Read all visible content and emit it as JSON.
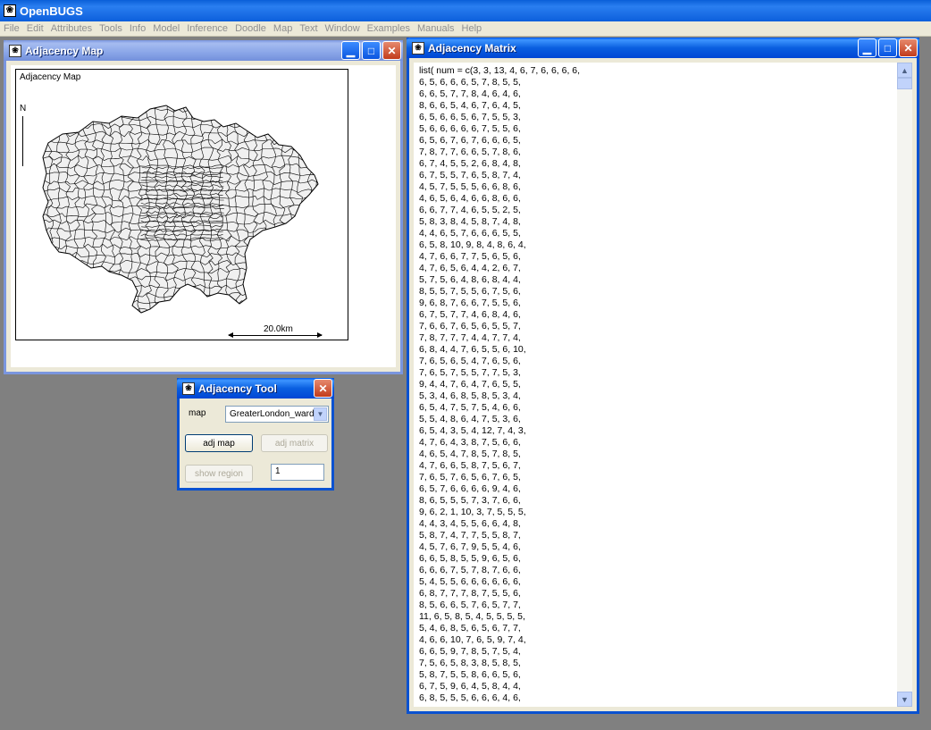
{
  "app": {
    "title": "OpenBUGS",
    "icon": "bugs-icon"
  },
  "menu": [
    "File",
    "Edit",
    "Attributes",
    "Tools",
    "Info",
    "Model",
    "Inference",
    "Doodle",
    "Map",
    "Text",
    "Window",
    "Examples",
    "Manuals",
    "Help"
  ],
  "map_window": {
    "title": "Adjacency Map",
    "map_label": "Adjacency Map",
    "north_label": "N",
    "scale_label": "20.0km"
  },
  "matrix_window": {
    "title": "Adjacency Matrix",
    "lines": [
      "list( num = c(3, 3, 13, 4, 6, 7, 6, 6, 6, 6,",
      "6, 5, 6, 6, 6, 5, 7, 8, 5, 5,",
      "6, 6, 5, 7, 7, 8, 4, 6, 4, 6,",
      "8, 6, 6, 5, 4, 6, 7, 6, 4, 5,",
      "6, 5, 6, 6, 5, 6, 7, 5, 5, 3,",
      "5, 6, 6, 6, 6, 6, 7, 5, 5, 6,",
      "6, 5, 6, 7, 6, 7, 6, 6, 6, 5,",
      "7, 8, 7, 7, 6, 6, 5, 7, 8, 6,",
      "6, 7, 4, 5, 5, 2, 6, 8, 4, 8,",
      "6, 7, 5, 5, 7, 6, 5, 8, 7, 4,",
      "4, 5, 7, 5, 5, 5, 6, 6, 8, 6,",
      "4, 6, 5, 6, 4, 6, 6, 8, 6, 6,",
      "6, 6, 7, 7, 4, 6, 5, 5, 2, 5,",
      "5, 8, 3, 8, 4, 5, 8, 7, 4, 8,",
      "4, 4, 6, 5, 7, 6, 6, 6, 5, 5,",
      "6, 5, 8, 10, 9, 8, 4, 8, 6, 4,",
      "4, 7, 6, 6, 7, 7, 5, 6, 5, 6,",
      "4, 7, 6, 5, 6, 4, 4, 2, 6, 7,",
      "5, 7, 5, 6, 4, 8, 6, 8, 4, 4,",
      "8, 5, 5, 7, 5, 5, 6, 7, 5, 6,",
      "9, 6, 8, 7, 6, 6, 7, 5, 5, 6,",
      "6, 7, 5, 7, 7, 4, 6, 8, 4, 6,",
      "7, 6, 6, 7, 6, 5, 6, 5, 5, 7,",
      "7, 8, 7, 7, 7, 4, 4, 7, 7, 4,",
      "6, 8, 4, 4, 7, 6, 5, 5, 6, 10,",
      "7, 6, 5, 6, 5, 4, 7, 6, 5, 6,",
      "7, 6, 5, 7, 5, 5, 7, 7, 5, 3,",
      "9, 4, 4, 7, 6, 4, 7, 6, 5, 5,",
      "5, 3, 4, 6, 8, 5, 8, 5, 3, 4,",
      "6, 5, 4, 7, 5, 7, 5, 4, 6, 6,",
      "5, 5, 4, 8, 6, 4, 7, 5, 3, 6,",
      "6, 5, 4, 3, 5, 4, 12, 7, 4, 3,",
      "4, 7, 6, 4, 3, 8, 7, 5, 6, 6,",
      "4, 6, 5, 4, 7, 8, 5, 7, 8, 5,",
      "4, 7, 6, 6, 5, 8, 7, 5, 6, 7,",
      "7, 6, 5, 7, 6, 5, 6, 7, 6, 5,",
      "6, 5, 7, 6, 6, 6, 6, 9, 4, 6,",
      "8, 6, 5, 5, 5, 7, 3, 7, 6, 6,",
      "9, 6, 2, 1, 10, 3, 7, 5, 5, 5,",
      "4, 4, 3, 4, 5, 5, 6, 6, 4, 8,",
      "5, 8, 7, 4, 7, 7, 5, 5, 8, 7,",
      "4, 5, 7, 6, 7, 9, 5, 5, 4, 6,",
      "6, 6, 5, 8, 5, 5, 9, 6, 5, 6,",
      "6, 6, 6, 7, 5, 7, 8, 7, 6, 6,",
      "5, 4, 5, 5, 6, 6, 6, 6, 6, 6,",
      "6, 8, 7, 7, 7, 8, 7, 5, 5, 6,",
      "8, 5, 6, 6, 5, 7, 6, 5, 7, 7,",
      "11, 6, 5, 8, 5, 4, 5, 5, 5, 5,",
      "5, 4, 6, 8, 5, 6, 5, 6, 7, 7,",
      "4, 6, 6, 10, 7, 6, 5, 9, 7, 4,",
      "6, 6, 5, 9, 7, 8, 5, 7, 5, 4,",
      "7, 5, 6, 5, 8, 3, 8, 5, 8, 5,",
      "5, 8, 7, 5, 5, 8, 6, 6, 5, 6,",
      "6, 7, 5, 9, 6, 4, 5, 8, 4, 4,",
      "6, 8, 5, 5, 5, 6, 6, 6, 4, 6,"
    ]
  },
  "tool_window": {
    "title": "Adjacency Tool",
    "map_label": "map",
    "map_value": "GreaterLondon_ward",
    "adj_map_label": "adj map",
    "adj_matrix_label": "adj matrix",
    "show_region_label": "show region",
    "region_value": "1"
  }
}
